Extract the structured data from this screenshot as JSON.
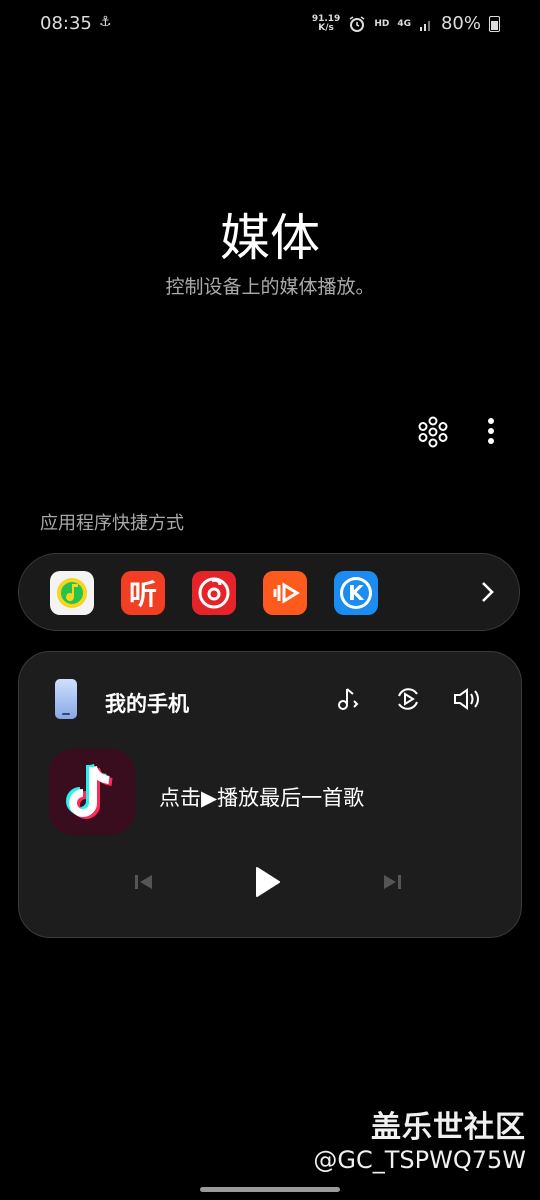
{
  "status_bar": {
    "time": "08:35",
    "speed_value": "91.19",
    "speed_unit": "K/s",
    "hd": "HD",
    "network": "4G",
    "battery": "80%"
  },
  "header": {
    "title": "媒体",
    "subtitle": "控制设备上的媒体播放。"
  },
  "shortcuts": {
    "label": "应用程序快捷方式",
    "apps": [
      {
        "icon": "qq-music-icon",
        "color": "#f4f4f4",
        "accent": "#27c24c"
      },
      {
        "icon": "ximalaya-icon",
        "color": "#f23e22",
        "glyph": "听"
      },
      {
        "icon": "netease-music-icon",
        "color": "#e5242a"
      },
      {
        "icon": "video-app-icon",
        "color": "#ff5a1e"
      },
      {
        "icon": "kugou-icon",
        "color": "#1b8cf0",
        "glyph": "K"
      }
    ]
  },
  "player": {
    "device_name": "我的手机",
    "track_text": "点击▶播放最后一首歌",
    "app_icon": "tiktok-icon"
  },
  "watermark": {
    "line1": "盖乐世社区",
    "line2": "@GC_TSPWQ75W"
  }
}
